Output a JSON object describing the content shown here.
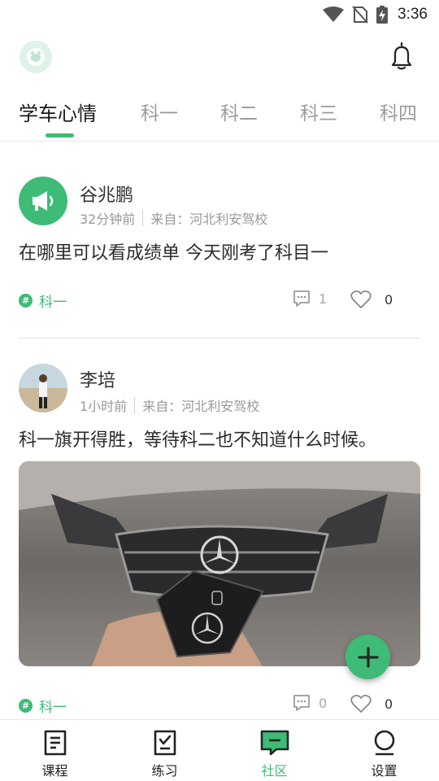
{
  "status_bar": {
    "time": "3:36",
    "icons": [
      "wifi-icon",
      "no-sim-icon",
      "battery-charging-icon"
    ]
  },
  "header": {
    "logo_icon": "app-logo-icon",
    "notification_icon": "bell-icon"
  },
  "tabs": [
    {
      "label": "学车心情",
      "active": true
    },
    {
      "label": "科一",
      "active": false
    },
    {
      "label": "科二",
      "active": false
    },
    {
      "label": "科三",
      "active": false
    },
    {
      "label": "科四",
      "active": false
    }
  ],
  "posts": [
    {
      "author": "谷兆鹏",
      "time_ago": "32分钟前",
      "source": "来自：河北利安驾校",
      "content": "在哪里可以看成绩单  今天刚考了科目一",
      "tag": "科一",
      "comments": "1",
      "likes": "0",
      "avatar_icon": "megaphone-icon"
    },
    {
      "author": "李培",
      "time_ago": "1小时前",
      "source": "来自：河北利安驾校",
      "content": "科一旗开得胜，等待科二也不知道什么时候。",
      "tag": "科一",
      "comments": "0",
      "likes": "0",
      "image": "car-key-photo"
    }
  ],
  "fab": {
    "icon": "plus-icon"
  },
  "bottom_nav": [
    {
      "label": "课程",
      "icon": "course-icon",
      "active": false
    },
    {
      "label": "练习",
      "icon": "practice-icon",
      "active": false
    },
    {
      "label": "社区",
      "icon": "community-icon",
      "active": true
    },
    {
      "label": "设置",
      "icon": "settings-icon",
      "active": false
    }
  ],
  "colors": {
    "accent": "#3dbb77",
    "text": "#222222",
    "muted": "#999999"
  }
}
